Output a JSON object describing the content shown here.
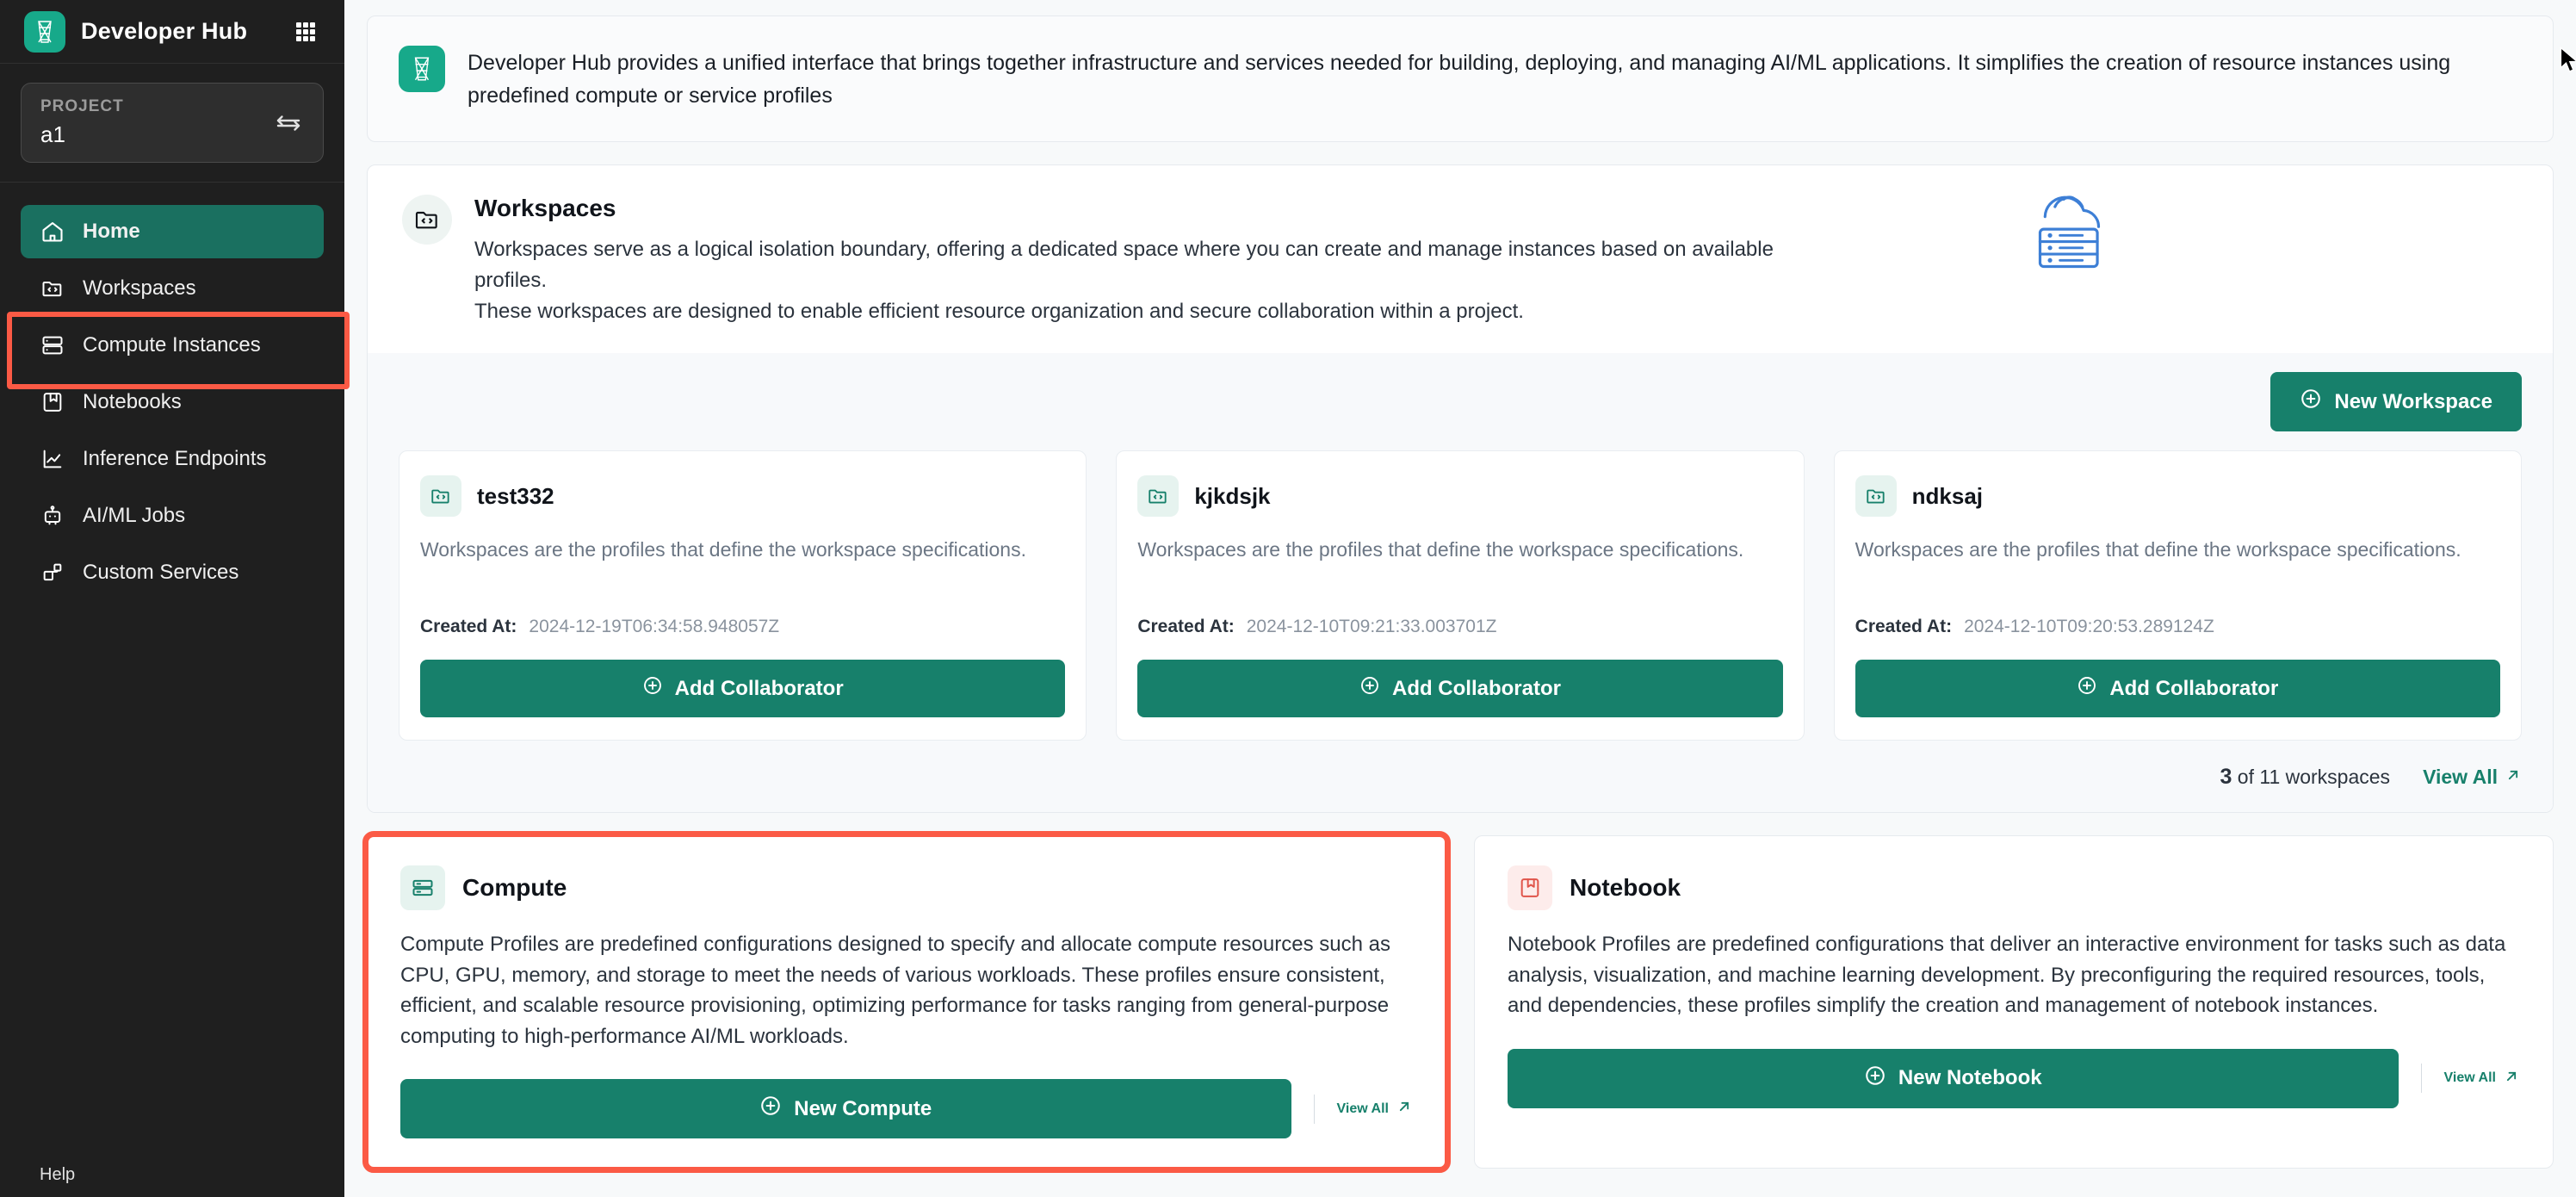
{
  "sidebar": {
    "brand": "Developer Hub",
    "grid_icon": "apps-grid-icon",
    "project": {
      "label": "PROJECT",
      "value": "a1",
      "swap_icon": "swap-icon"
    },
    "items": [
      {
        "label": "Home",
        "icon": "home-icon",
        "active": true
      },
      {
        "label": "Workspaces",
        "icon": "folder-code-icon",
        "active": false
      },
      {
        "label": "Compute Instances",
        "icon": "server-icon",
        "active": false
      },
      {
        "label": "Notebooks",
        "icon": "notebook-icon",
        "active": false
      },
      {
        "label": "Inference Endpoints",
        "icon": "chart-line-icon",
        "active": false
      },
      {
        "label": "AI/ML Jobs",
        "icon": "robot-icon",
        "active": false
      },
      {
        "label": "Custom Services",
        "icon": "blocks-icon",
        "active": false
      }
    ],
    "footer": "Help"
  },
  "banner": {
    "icon": "developer-hub-logo-icon",
    "text": "Developer Hub provides a unified interface that brings together infrastructure and services needed for building, deploying, and managing AI/ML applications. It simplifies the creation of resource instances using predefined compute or service profiles"
  },
  "workspaces": {
    "icon": "folder-code-icon",
    "title": "Workspaces",
    "desc_line1": "Workspaces serve as a logical isolation boundary, offering a dedicated space where you can create and manage instances based on available profiles.",
    "desc_line2": "These workspaces are designed to enable efficient resource organization and secure collaboration within a project.",
    "illustration_icon": "cloud-server-icon",
    "new_button": "New Workspace",
    "new_button_icon": "plus-circle-icon",
    "cards": [
      {
        "name": "test332",
        "icon": "folder-code-icon",
        "desc": "Workspaces are the profiles that define the workspace specifications.",
        "meta_key": "Created At:",
        "meta_value": "2024-12-19T06:34:58.948057Z",
        "action": "Add Collaborator",
        "action_icon": "plus-circle-icon"
      },
      {
        "name": "kjkdsjk",
        "icon": "folder-code-icon",
        "desc": "Workspaces are the profiles that define the workspace specifications.",
        "meta_key": "Created At:",
        "meta_value": "2024-12-10T09:21:33.003701Z",
        "action": "Add Collaborator",
        "action_icon": "plus-circle-icon"
      },
      {
        "name": "ndksaj",
        "icon": "folder-code-icon",
        "desc": "Workspaces are the profiles that define the workspace specifications.",
        "meta_key": "Created At:",
        "meta_value": "2024-12-10T09:20:53.289124Z",
        "action": "Add Collaborator",
        "action_icon": "plus-circle-icon"
      }
    ],
    "footer_count": "3",
    "footer_rest": "of 11 workspaces",
    "footer_link": "View All",
    "footer_link_icon": "external-link-icon"
  },
  "profiles": [
    {
      "title": "Compute",
      "icon": "compute-icon",
      "desc": "Compute Profiles are predefined configurations designed to specify and allocate compute resources such as CPU, GPU, memory, and storage to meet the needs of various workloads. These profiles ensure consistent, efficient, and scalable resource provisioning, optimizing performance for tasks ranging from general-purpose computing to high-performance AI/ML workloads.",
      "button": "New Compute",
      "button_icon": "plus-circle-icon",
      "link": "View All",
      "link_icon": "external-link-icon",
      "highlighted": true
    },
    {
      "title": "Notebook",
      "icon": "notebook-icon",
      "desc": "Notebook Profiles are predefined configurations that deliver an interactive environment for tasks such as data analysis, visualization, and machine learning development. By preconfiguring the required resources, tools, and dependencies, these profiles simplify the creation and management of notebook instances.",
      "button": "New Notebook",
      "button_icon": "plus-circle-icon",
      "link": "View All",
      "link_icon": "external-link-icon",
      "highlighted": false
    }
  ],
  "colors": {
    "brand_green": "#17a98a",
    "accent_green": "#17806b",
    "active_nav": "#1a7060",
    "highlight_red": "#fb5a45",
    "sidebar_bg": "#1f1f1f"
  },
  "cursor": {
    "icon": "mouse-pointer-icon"
  }
}
